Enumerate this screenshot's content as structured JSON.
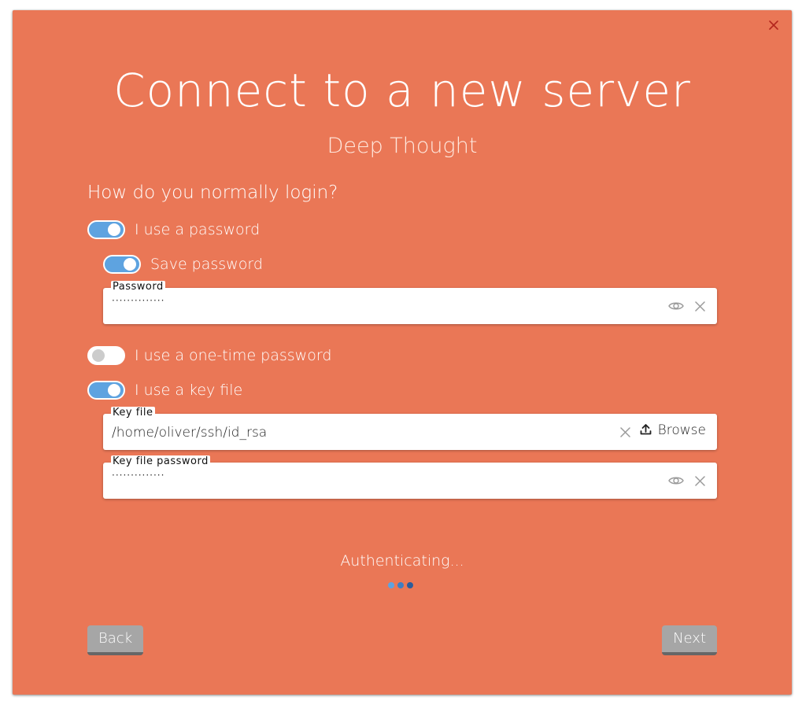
{
  "dialog": {
    "title": "Connect to a new server",
    "subtitle": "Deep Thought",
    "close_icon": "close-icon",
    "accent_color": "#ea7756"
  },
  "login": {
    "question": "How do you normally login?",
    "use_password": {
      "label": "I use a password",
      "enabled": true
    },
    "save_password": {
      "label": "Save password",
      "enabled": true
    },
    "password_field": {
      "label": "Password",
      "value": "··············",
      "icons": [
        "eye-icon",
        "clear-icon"
      ]
    },
    "use_otp": {
      "label": "I use a one-time password",
      "enabled": false
    },
    "use_key_file": {
      "label": "I use a key file",
      "enabled": true
    },
    "key_file_field": {
      "label": "Key file",
      "value": "/home/oliver/ssh/id_rsa",
      "browse_label": "Browse",
      "icons": [
        "clear-icon",
        "upload-icon"
      ]
    },
    "key_file_password_field": {
      "label": "Key file password",
      "value": "··············",
      "icons": [
        "eye-icon",
        "clear-icon"
      ]
    }
  },
  "status": {
    "text": "Authenticating...",
    "dot_colors": [
      "#5ea3e0",
      "#3f7ec2",
      "#2b5c9a"
    ]
  },
  "footer": {
    "back_label": "Back",
    "next_label": "Next"
  }
}
